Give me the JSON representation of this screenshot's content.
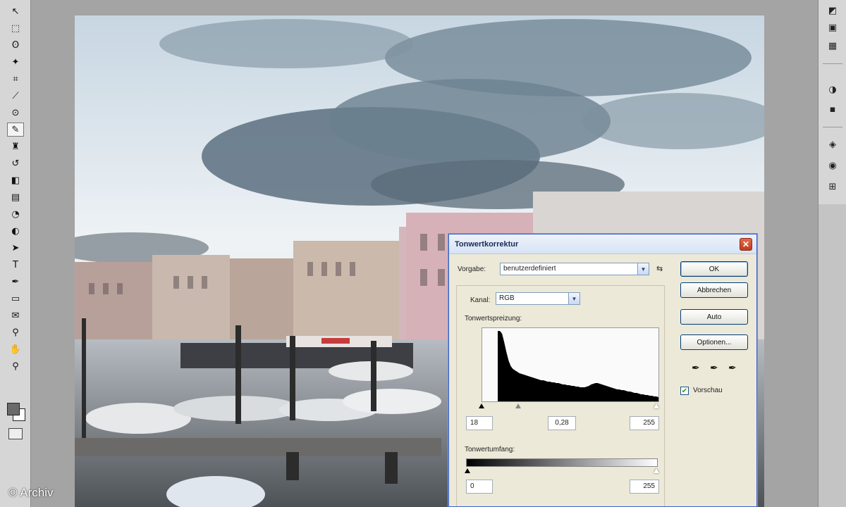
{
  "toolbox": {
    "tools": [
      {
        "name": "move-tool-icon",
        "glyph": "↖"
      },
      {
        "name": "marquee-tool-icon",
        "glyph": "⬚"
      },
      {
        "name": "lasso-tool-icon",
        "glyph": "ʘ"
      },
      {
        "name": "magic-wand-tool-icon",
        "glyph": "✦"
      },
      {
        "name": "crop-tool-icon",
        "glyph": "⌗"
      },
      {
        "name": "slice-tool-icon",
        "glyph": "⟋"
      },
      {
        "name": "healing-brush-tool-icon",
        "glyph": "⊙"
      },
      {
        "name": "brush-tool-icon",
        "glyph": "✎"
      },
      {
        "name": "clone-stamp-tool-icon",
        "glyph": "♜"
      },
      {
        "name": "history-brush-tool-icon",
        "glyph": "↺"
      },
      {
        "name": "eraser-tool-icon",
        "glyph": "◧"
      },
      {
        "name": "gradient-tool-icon",
        "glyph": "▤"
      },
      {
        "name": "blur-tool-icon",
        "glyph": "◔"
      },
      {
        "name": "dodge-tool-icon",
        "glyph": "◐"
      },
      {
        "name": "path-selection-tool-icon",
        "glyph": "➤"
      },
      {
        "name": "type-tool-icon",
        "glyph": "T"
      },
      {
        "name": "pen-tool-icon",
        "glyph": "✒"
      },
      {
        "name": "shape-tool-icon",
        "glyph": "▭"
      },
      {
        "name": "notes-tool-icon",
        "glyph": "✉"
      },
      {
        "name": "eyedropper-tool-icon",
        "glyph": "⚲"
      },
      {
        "name": "hand-tool-icon",
        "glyph": "✋"
      },
      {
        "name": "zoom-tool-icon",
        "glyph": "⚲"
      }
    ]
  },
  "palette": {
    "icons": [
      {
        "name": "navigator-icon",
        "glyph": "◩"
      },
      {
        "name": "info-icon",
        "glyph": "▣"
      },
      {
        "name": "histogram-icon",
        "glyph": "▦"
      },
      {
        "name": "color-icon",
        "glyph": "◑"
      },
      {
        "name": "swatches-icon",
        "glyph": "▪"
      },
      {
        "name": "layers-icon",
        "glyph": "◈"
      },
      {
        "name": "channels-icon",
        "glyph": "◉"
      },
      {
        "name": "paths-icon",
        "glyph": "⊞"
      }
    ]
  },
  "dialog": {
    "title": "Tonwertkorrektur",
    "close_glyph": "✕",
    "preset_label": "Vorgabe:",
    "preset_value": "benutzerdefiniert",
    "preset_menu_glyph": "⇆",
    "channel_label": "Kanal:",
    "channel_value": "RGB",
    "input_levels_label": "Tonwertspreizung:",
    "input_black": "18",
    "input_gamma": "0,28",
    "input_white": "255",
    "output_levels_label": "Tonwertumfang:",
    "output_black": "0",
    "output_white": "255",
    "buttons": {
      "ok": "OK",
      "cancel": "Abbrechen",
      "auto": "Auto",
      "options": "Optionen..."
    },
    "preview_label": "Vorschau",
    "preview_checked": true,
    "histogram_values": [
      100,
      100,
      96,
      84,
      70,
      58,
      50,
      46,
      44,
      42,
      40,
      39,
      38,
      37,
      36,
      35,
      34,
      33,
      32,
      31,
      30,
      30,
      29,
      28,
      28,
      27,
      27,
      26,
      26,
      25,
      24,
      24,
      23,
      23,
      22,
      22,
      21,
      21,
      20,
      20,
      20,
      21,
      22,
      24,
      25,
      26,
      26,
      25,
      24,
      23,
      22,
      21,
      20,
      19,
      18,
      17,
      17,
      16,
      16,
      15,
      14,
      14,
      13,
      12,
      12,
      11,
      10,
      10,
      9,
      9,
      8,
      8,
      7,
      7,
      6
    ]
  },
  "credit": "© Archiv"
}
